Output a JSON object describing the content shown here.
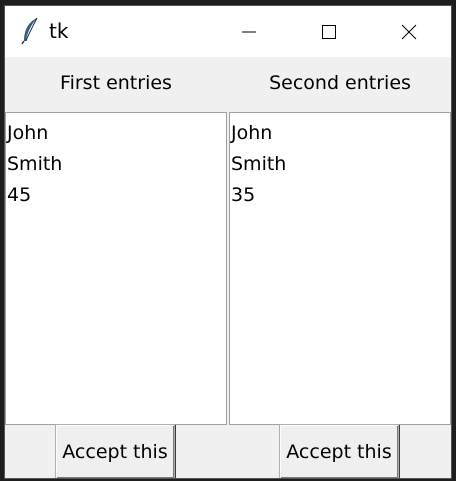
{
  "window": {
    "title": "tk",
    "icons": {
      "app": "tk-feather-icon",
      "minimize": "minimize-icon",
      "maximize": "maximize-icon",
      "close": "close-icon"
    }
  },
  "columns": [
    {
      "label": "First entries",
      "items": [
        "John",
        "Smith",
        "45"
      ],
      "button_label": "Accept this"
    },
    {
      "label": "Second entries",
      "items": [
        "John",
        "Smith",
        "35"
      ],
      "button_label": "Accept this"
    }
  ]
}
